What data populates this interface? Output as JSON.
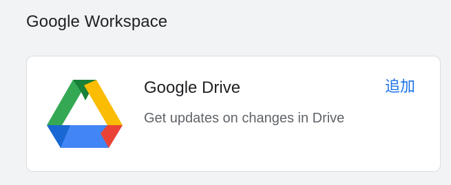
{
  "section": {
    "title": "Google Workspace"
  },
  "card": {
    "app_name": "Google Drive",
    "description": "Get updates on changes in Drive",
    "add_label": "追加",
    "icon": "google-drive-icon"
  },
  "colors": {
    "background": "#f1f3f4",
    "card_background": "#ffffff",
    "accent": "#1a73e8",
    "drive_green": "#34a853",
    "drive_yellow": "#fbbc04",
    "drive_blue": "#4285f4",
    "drive_dark_blue": "#1967d2",
    "drive_red": "#ea4335",
    "drive_dark_green": "#188038"
  }
}
